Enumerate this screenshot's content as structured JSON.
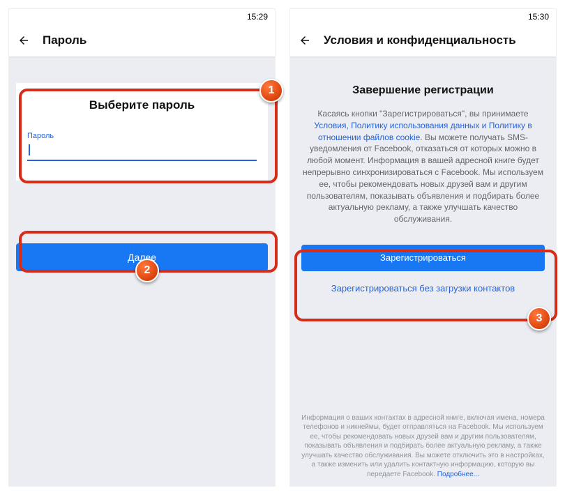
{
  "annotation_badges": {
    "b1": "1",
    "b2": "2",
    "b3": "3"
  },
  "phone_left": {
    "status_time": "15:29",
    "appbar_title": "Пароль",
    "card_heading": "Выберите пароль",
    "password_label": "Пароль",
    "next_button": "Далее"
  },
  "phone_right": {
    "status_time": "15:30",
    "appbar_title": "Условия и конфиденциальность",
    "heading": "Завершение регистрации",
    "intro_prefix": "Касаясь кнопки \"Зарегистрироваться\", вы принимаете ",
    "links_line": "Условия, Политику использования данных и Политику в отношении файлов cookie",
    "body_rest": ". Вы можете получать SMS-уведомления от Facebook, отказаться от которых можно в любой момент. Информация в вашей адресной книге будет непрерывно синхронизироваться с Facebook. Мы используем ее, чтобы рекомендовать новых друзей вам и другим пользователям, показывать объявления и подбирать более актуальную рекламу, а также улучшать качество обслуживания.",
    "register_button": "Зарегистрироваться",
    "register_without_contacts": "Зарегистрироваться без загрузки контактов",
    "footer_text": "Информация о ваших контактах в адресной книге, включая имена, номера телефонов и никнеймы, будет отправляться на Facebook. Мы используем ее, чтобы рекомендовать новых друзей вам и другим пользователям, показывать объявления и подбирать более актуальную рекламу, а также улучшать качество обслуживания. Вы можете отключить это в настройках, а также изменить или удалить контактную информацию, которую вы передаете Facebook.",
    "footer_more": "Подробнее..."
  }
}
